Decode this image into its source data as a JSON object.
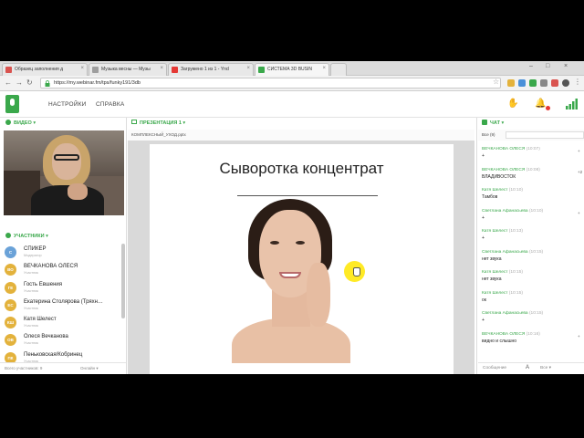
{
  "browser": {
    "tabs": [
      {
        "label": "Образец заполнения д",
        "color": "#d9534f"
      },
      {
        "label": "Музыка весны — Музы",
        "color": "#9e9e9e"
      },
      {
        "label": "Загружено 1 из 1 - Ynd",
        "color": "#e53935"
      },
      {
        "label": "СИСТЕМА 3D BUSIN",
        "color": "#3aa84b"
      }
    ],
    "url": "https://my.webinar.fm/tps/funky191/3db"
  },
  "app": {
    "menu_settings": "НАСТРОЙКИ",
    "menu_help": "СПРАВКА"
  },
  "video_panel": {
    "title": "ВИДЕО"
  },
  "participants_panel": {
    "title": "УЧАСТНИКИ",
    "items": [
      {
        "avatar": "С",
        "name": "СПИКЕР",
        "role": "Модератор",
        "color": "#6aa2d8"
      },
      {
        "avatar": "ВО",
        "name": "ВЕЧКАНОВА ОЛЕСЯ",
        "role": "Участник",
        "color": "#e3b23c"
      },
      {
        "avatar": "ГЕ",
        "name": "Гость Евшения",
        "role": "Участник",
        "color": "#e3b23c"
      },
      {
        "avatar": "ЕС",
        "name": "Екатерина Столярова (Тряхн…",
        "role": "Участник",
        "color": "#e3b23c"
      },
      {
        "avatar": "КШ",
        "name": "Катя Шелест",
        "role": "Участник",
        "color": "#e3b23c"
      },
      {
        "avatar": "ОВ",
        "name": "Олеся Вечканова",
        "role": "Участник",
        "color": "#e3b23c"
      },
      {
        "avatar": "ПК",
        "name": "Пеньковская/Кобринец",
        "role": "Участник",
        "color": "#e3b23c"
      }
    ],
    "footer_left": "Всего участников: 9",
    "footer_right": "Онлайн"
  },
  "presentation_panel": {
    "title": "ПРЕЗЕНТАЦИЯ 1",
    "file": "КОМПЛЕКСНЫЙ_УХОД.pptx",
    "slide_title": "Сыворотка концентрат"
  },
  "chat_panel": {
    "title": "ЧАТ",
    "filter": "Все",
    "filter_count": "(9)",
    "messages": [
      {
        "author": "ВЕЧКАНОВА ОЛЕСЯ",
        "time": "(10:07)",
        "text": "+"
      },
      {
        "author": "ВЕЧКАНОВА ОЛЕСЯ",
        "time": "(10:08)",
        "text": "ВЛАДИВОСТОК"
      },
      {
        "author": "Катя Шелест",
        "time": "(10:10)",
        "text": "Тамбов"
      },
      {
        "author": "Светлана Афанасьева",
        "time": "(10:10)",
        "text": "+"
      },
      {
        "author": "Катя Шелест",
        "time": "(10:13)",
        "text": "+"
      },
      {
        "author": "Светлана Афанасьева",
        "time": "(10:15)",
        "text": "нет звука"
      },
      {
        "author": "Катя Шелест",
        "time": "(10:15)",
        "text": "нет звука"
      },
      {
        "author": "Катя Шелест",
        "time": "(10:15)",
        "text": "ок"
      },
      {
        "author": "Светлана Афанасьева",
        "time": "(10:15)",
        "text": "+"
      },
      {
        "author": "ВЕЧКАНОВА ОЛЕСЯ",
        "time": "(10:16)",
        "text": "видно и слышно"
      }
    ],
    "side_marks": [
      "+",
      "+2",
      "",
      "+",
      "",
      "",
      "",
      "",
      "",
      "+"
    ],
    "footer_left": "Сообщение",
    "footer_right": "Все"
  }
}
